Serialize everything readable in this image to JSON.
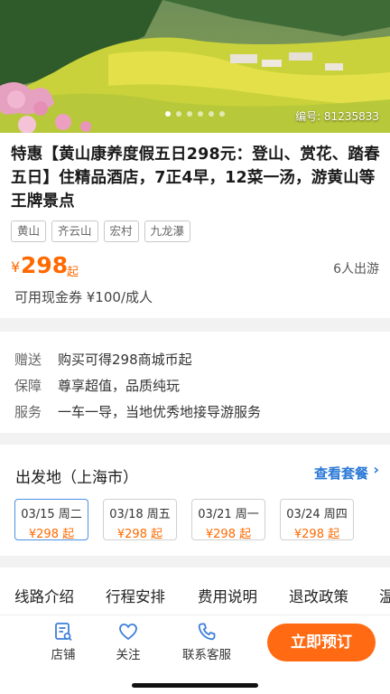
{
  "hero": {
    "code_text": "编号: 81235833",
    "dot_count": 6,
    "active_dot": 0
  },
  "product": {
    "title": "特惠【黄山康养度假五日298元：登山、赏花、踏春五日】住精品酒店，7正4早，12菜一汤，游黄山等王牌景点",
    "tags": [
      "黄山",
      "齐云山",
      "宏村",
      "九龙瀑"
    ],
    "price_currency": "¥",
    "price": "298",
    "price_suffix": "起",
    "group_count": "6人出游",
    "coupon": "可用现金券 ¥100/成人"
  },
  "benefits": [
    {
      "label": "赠送",
      "text": "购买可得298商城币起"
    },
    {
      "label": "保障",
      "text": "尊享超值，品质纯玩"
    },
    {
      "label": "服务",
      "text": "一车一导，当地优秀地接导游服务"
    }
  ],
  "departure": {
    "title": "出发地（上海市）",
    "view_packages": "查看套餐",
    "dates": [
      {
        "day": "03/15 周二",
        "price": "¥298 起",
        "active": true
      },
      {
        "day": "03/18 周五",
        "price": "¥298 起",
        "active": false
      },
      {
        "day": "03/21 周一",
        "price": "¥298 起",
        "active": false
      },
      {
        "day": "03/24 周四",
        "price": "¥298 起",
        "active": false
      }
    ]
  },
  "tabs": [
    "线路介绍",
    "行程安排",
    "费用说明",
    "退改政策",
    "温"
  ],
  "bottom_bar": {
    "shop": "店铺",
    "follow": "关注",
    "contact": "联系客服",
    "book": "立即预订"
  },
  "colors": {
    "accent_orange": "#ff6a13",
    "price_orange": "#ff6a00",
    "link_blue": "#2b79d6",
    "icon_blue": "#3d7fd9"
  }
}
